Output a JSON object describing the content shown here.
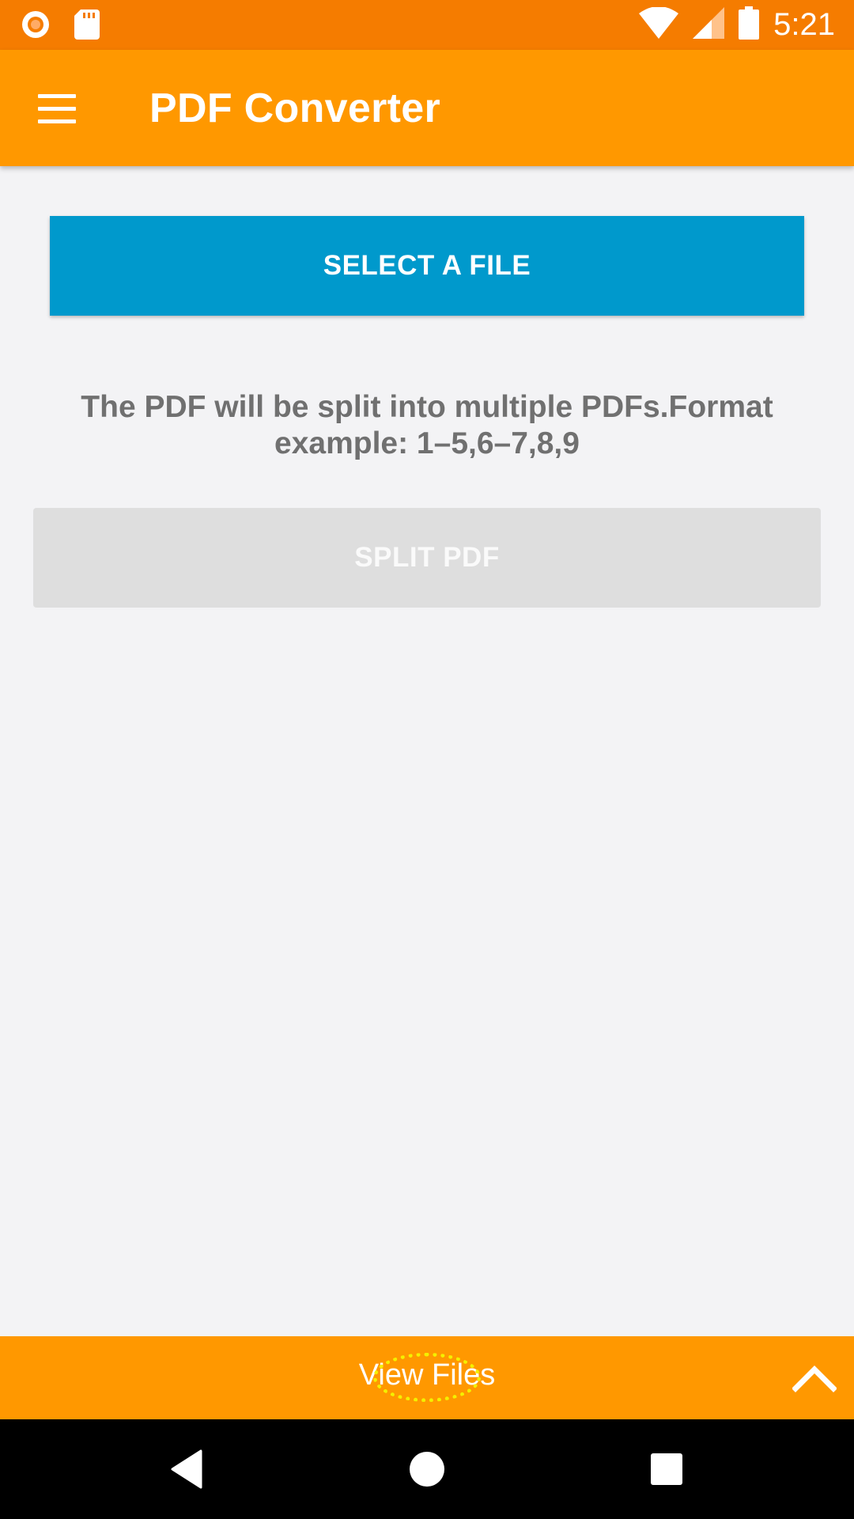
{
  "status_bar": {
    "time": "5:21",
    "icons": [
      "notification-record-icon",
      "sd-card-icon",
      "wifi-icon",
      "cell-signal-icon",
      "battery-icon"
    ]
  },
  "app_bar": {
    "title": "PDF Converter",
    "menu_icon": "hamburger-menu-icon"
  },
  "main": {
    "select_button_label": "SELECT A FILE",
    "hint_text": "The PDF will be split into multiple PDFs.Format example: 1–5,6–7,8,9",
    "split_button_label": "SPLIT PDF"
  },
  "bottom_sheet": {
    "label": "View Files",
    "expand_icon": "chevron-up-icon"
  },
  "nav_bar": {
    "icons": [
      "back-icon",
      "home-icon",
      "recents-icon"
    ]
  },
  "colors": {
    "status_bar": "#f57c00",
    "app_bar": "#ff9800",
    "select_button": "#0099cc",
    "split_button_disabled": "#dedede",
    "hint_text": "#707070",
    "background": "#f3f3f5"
  }
}
